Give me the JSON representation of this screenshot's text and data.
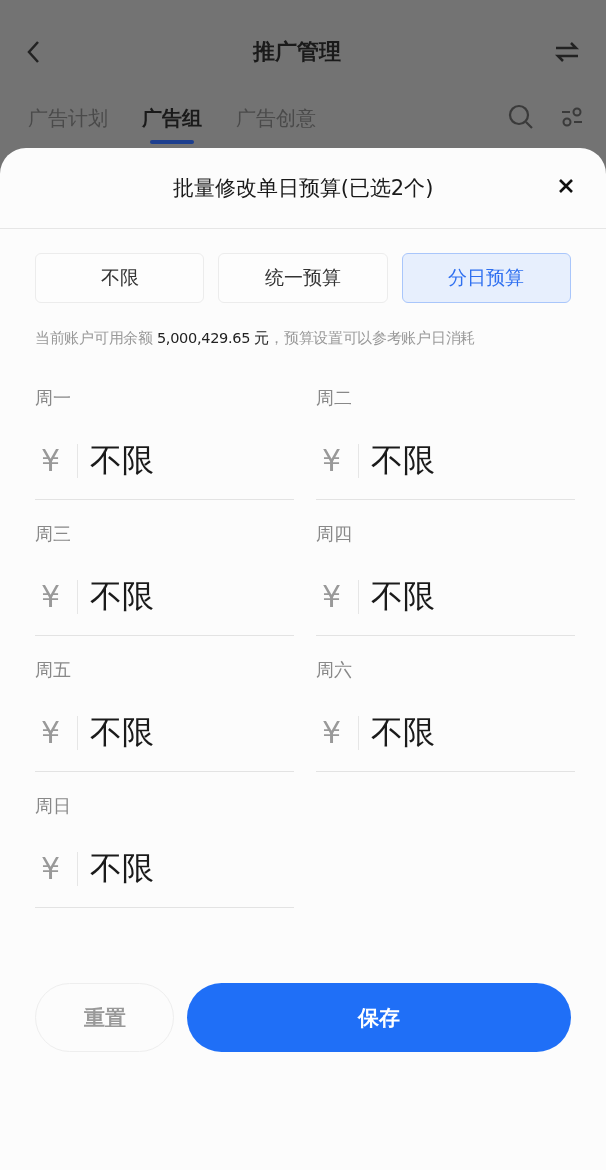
{
  "header": {
    "title": "推广管理"
  },
  "tabs": [
    {
      "label": "广告计划",
      "selected": false
    },
    {
      "label": "广告组",
      "selected": true
    },
    {
      "label": "广告创意",
      "selected": false
    }
  ],
  "sheet": {
    "title": "批量修改单日预算(已选2个)",
    "budget_modes": [
      {
        "label": "不限",
        "selected": false
      },
      {
        "label": "统一预算",
        "selected": false
      },
      {
        "label": "分日预算",
        "selected": true
      }
    ],
    "note": "当前账户可用余额 **5,000,429.65 元**，预算设置可以参考账户日消耗",
    "days": [
      {
        "label": "周一",
        "currency": "¥",
        "value": "不限"
      },
      {
        "label": "周二",
        "currency": "¥",
        "value": "不限"
      },
      {
        "label": "周三",
        "currency": "¥",
        "value": "不限"
      },
      {
        "label": "周四",
        "currency": "¥",
        "value": "不限"
      },
      {
        "label": "周五",
        "currency": "¥",
        "value": "不限"
      },
      {
        "label": "周六",
        "currency": "¥",
        "value": "不限"
      },
      {
        "label": "周日",
        "currency": "¥",
        "value": "不限"
      }
    ],
    "buttons": [
      {
        "kind": "secondary",
        "label": "重置"
      },
      {
        "kind": "primary",
        "label": "保存"
      }
    ]
  }
}
